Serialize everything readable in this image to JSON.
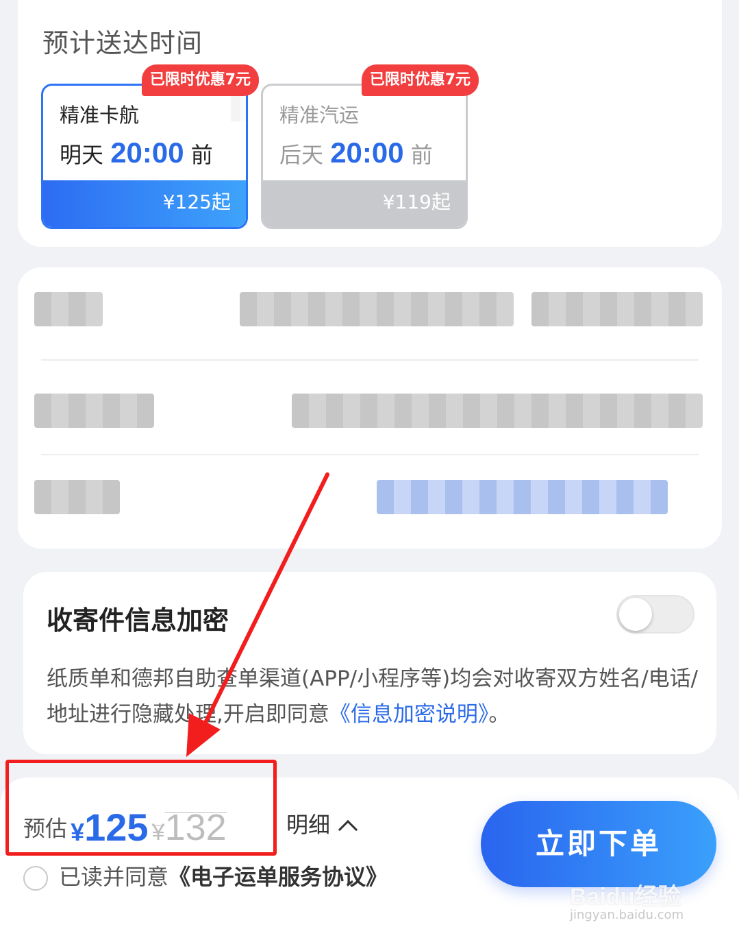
{
  "delivery": {
    "title": "预计送达时间",
    "options": [
      {
        "name": "精准卡航",
        "day": "明天",
        "time": "20:00",
        "suffix": "前",
        "price": "¥125起",
        "promo": "已限时优惠7元",
        "selected": true
      },
      {
        "name": "精准汽运",
        "day": "后天",
        "time": "20:00",
        "suffix": "前",
        "price": "¥119起",
        "promo": "已限时优惠7元",
        "selected": false
      }
    ]
  },
  "encrypt": {
    "title": "收寄件信息加密",
    "desc_prefix": "纸质单和德邦自助查单渠道(APP/小程序等)均会对收寄双方姓名/电话/地址进行隐藏处理,开启即同意",
    "desc_link": "《信息加密说明》",
    "desc_suffix": "。",
    "enabled": false
  },
  "bottom": {
    "estimate_label": "预估",
    "currency": "¥",
    "price": "125",
    "original_currency": "¥",
    "original_price": "132",
    "detail_label": "明细",
    "agree_prefix": "已读并同意",
    "agree_link": "《电子运单服务协议》",
    "submit_label": "立即下单"
  },
  "watermark": {
    "text": "Baidu经验",
    "sub": "jingyan.baidu.com"
  },
  "colors": {
    "accent": "#2a6ae8",
    "promo": "#f23e3e",
    "annotation": "#f21d1d"
  }
}
